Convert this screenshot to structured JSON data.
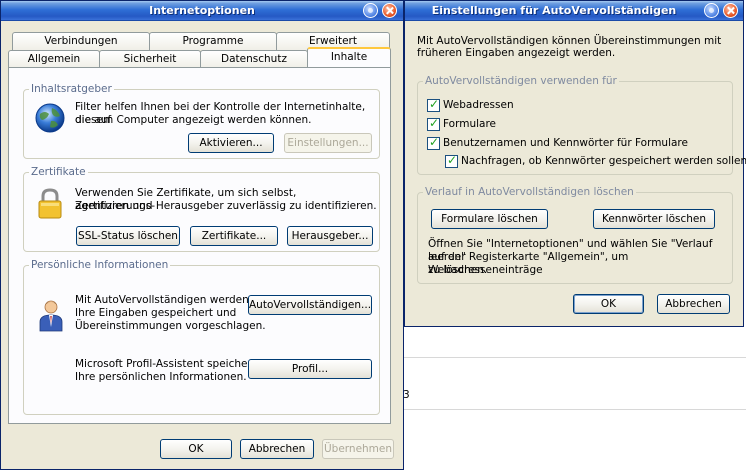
{
  "internet_options": {
    "title": "Internetoptionen",
    "tabs_back": [
      "Verbindungen",
      "Programme",
      "Erweitert"
    ],
    "tabs_front": [
      "Allgemein",
      "Sicherheit",
      "Datenschutz",
      "Inhalte"
    ],
    "active_tab": "Inhalte",
    "content_advisor": {
      "title": "Inhaltsratgeber",
      "description_1": "Filter helfen Ihnen bei der Kontrolle der Internetinhalte, die auf",
      "description_2": "diesem Computer angezeigt werden können.",
      "activate_label": "Aktivieren...",
      "settings_label": "Einstellungen..."
    },
    "certificates": {
      "title": "Zertifikate",
      "description_1": "Verwenden Sie Zertifikate, um sich selbst, Zertifizierungs-",
      "description_2": "agenturen und Herausgeber zuverlässig zu identifizieren.",
      "ssl_label": "SSL-Status löschen",
      "certs_label": "Zertifikate...",
      "publishers_label": "Herausgeber..."
    },
    "personal": {
      "title": "Persönliche Informationen",
      "autocomplete_1": "Mit AutoVervollständigen werden",
      "autocomplete_2": "Ihre Eingaben gespeichert und",
      "autocomplete_3": "Übereinstimmungen vorgeschlagen.",
      "autocomplete_button": "AutoVervollständigen...",
      "profile_1": "Microsoft Profil-Assistent speichert",
      "profile_2": "Ihre persönlichen Informationen.",
      "profile_button": "Profil..."
    },
    "ok_label": "OK",
    "cancel_label": "Abbrechen",
    "apply_label": "Übernehmen"
  },
  "autocomplete_settings": {
    "title": "Einstellungen für AutoVervollständigen",
    "intro_1": "Mit AutoVervollständigen können Übereinstimmungen mit",
    "intro_2": "früheren Eingaben angezeigt werden.",
    "use_group_title": "AutoVervollständigen verwenden für",
    "checkboxes": [
      {
        "label": "Webadressen",
        "checked": true
      },
      {
        "label": "Formulare",
        "checked": true
      },
      {
        "label": "Benutzernamen und Kennwörter für Formulare",
        "checked": true
      },
      {
        "label": "Nachfragen, ob Kennwörter gespeichert werden sollen",
        "checked": true
      }
    ],
    "clear_group_title": "Verlauf in AutoVervollständigen löschen",
    "clear_forms_label": "Formulare löschen",
    "clear_passwords_label": "Kennwörter löschen",
    "info_1": "Öffnen Sie \"Internetoptionen\" und wählen Sie \"Verlauf leeren\"",
    "info_2": "auf der Registerkarte \"Allgemein\", um Webadresseneinträge",
    "info_3": "zu löschen.",
    "ok_label": "OK",
    "cancel_label": "Abbrechen"
  },
  "background": {
    "stray_char": "3"
  },
  "colors": {
    "title_blue": "#2559c4",
    "group_title": "#5a6b8c",
    "active_tab_accent": "#ffc83c",
    "check_green": "#21a121"
  }
}
